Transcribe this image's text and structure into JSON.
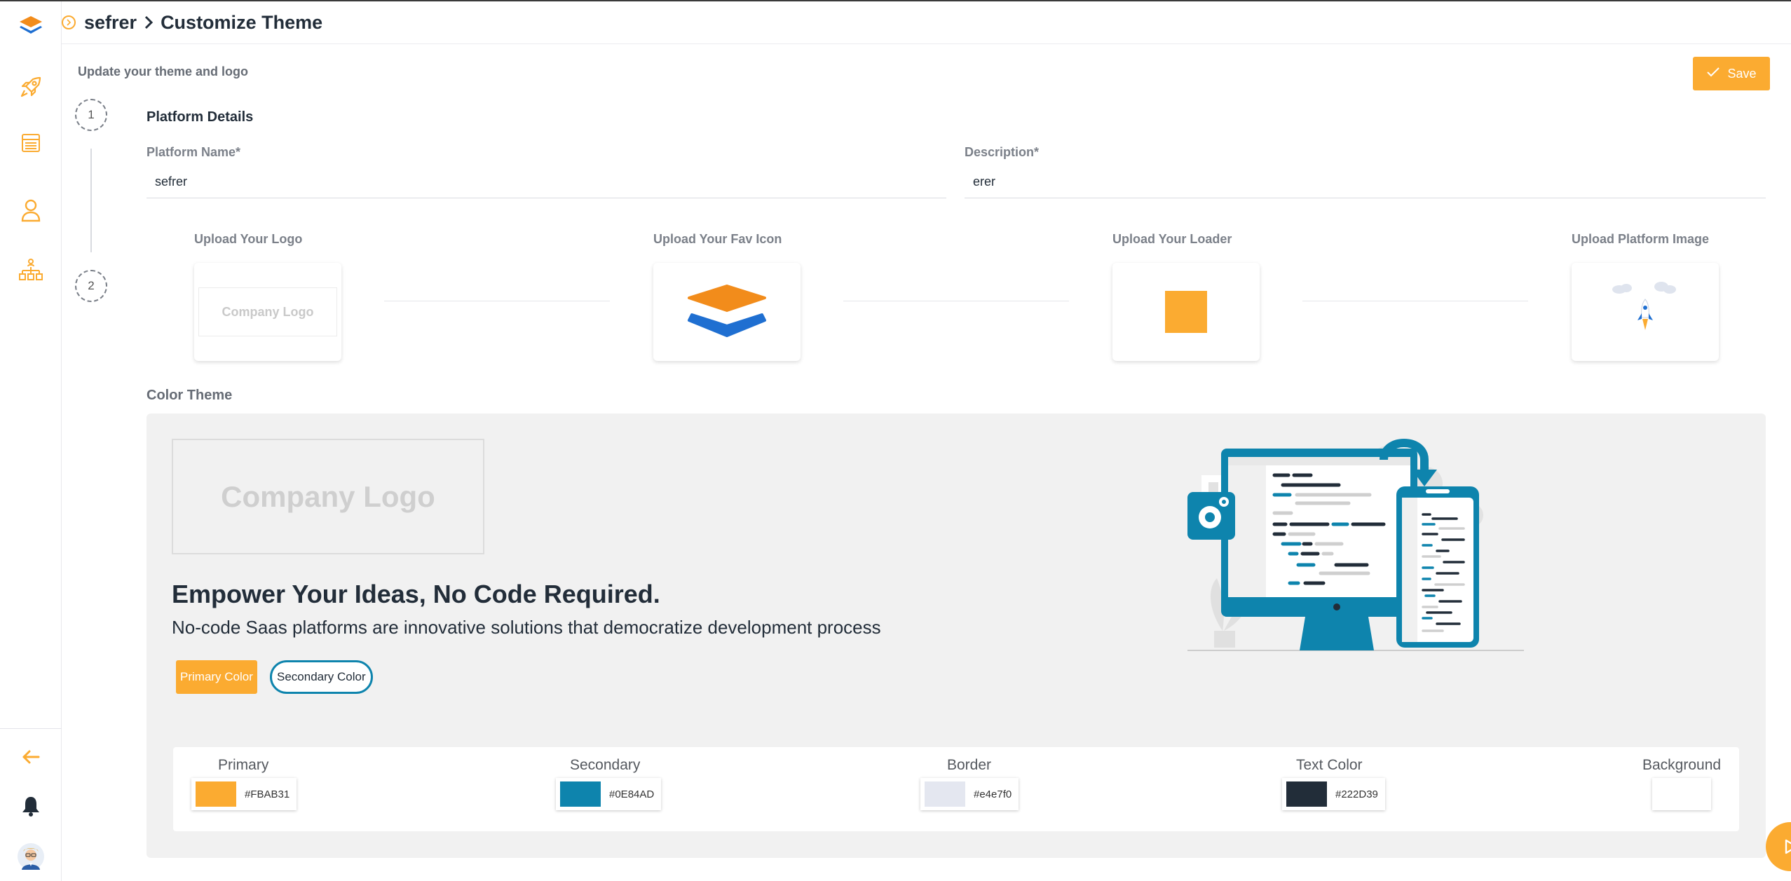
{
  "header": {
    "platform": "sefrer",
    "page_title": "Customize Theme"
  },
  "subtitle": "Update your theme and logo",
  "save_label": "Save",
  "steps": [
    "1",
    "2"
  ],
  "platform_details": {
    "title": "Platform Details",
    "name_label": "Platform Name*",
    "name_value": "sefrer",
    "description_label": "Description*",
    "description_value": "erer"
  },
  "uploads": {
    "logo_label": "Upload Your Logo",
    "logo_placeholder": "Company Logo",
    "favicon_label": "Upload Your Fav Icon",
    "loader_label": "Upload Your Loader",
    "platform_image_label": "Upload Platform Image"
  },
  "color_theme": {
    "title": "Color Theme",
    "logo_placeholder": "Company Logo",
    "headline": "Empower Your Ideas, No Code Required.",
    "tagline": "No-code Saas platforms are innovative solutions that democratize development process",
    "primary_button": "Primary Color",
    "secondary_button": "Secondary Color"
  },
  "palette": [
    {
      "name": "Primary",
      "hex": "#FBAB31",
      "color": "#FBAB31"
    },
    {
      "name": "Secondary",
      "hex": "#0E84AD",
      "color": "#0E84AD"
    },
    {
      "name": "Border",
      "hex": "#e4e7f0",
      "color": "#e4e7f0"
    },
    {
      "name": "Text Color",
      "hex": "#222D39",
      "color": "#222D39"
    },
    {
      "name": "Background",
      "hex": "",
      "color": "#ffffff"
    }
  ],
  "colors": {
    "accent": "#FBAB31",
    "secondary": "#0E84AD",
    "text": "#222D39"
  },
  "icons": {
    "sidebar": [
      "layers-logo-icon",
      "rocket-icon",
      "layout-icon",
      "user-icon",
      "org-chart-icon"
    ],
    "sidebar_bottom": [
      "arrow-left-icon",
      "bell-icon",
      "avatar"
    ]
  }
}
